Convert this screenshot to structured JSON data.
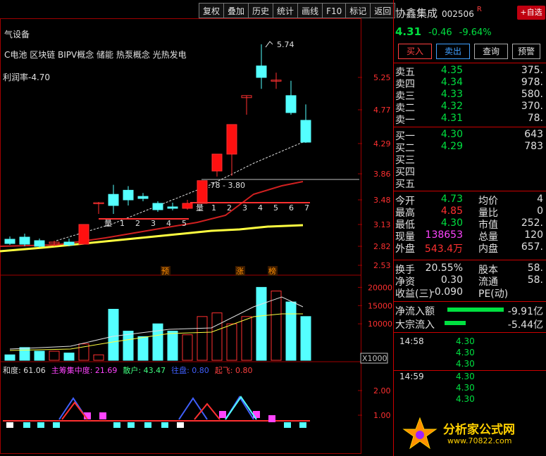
{
  "toolbar": {
    "buttons": [
      "复权",
      "叠加",
      "历史",
      "统计",
      "画线",
      "F10",
      "标记",
      "返回"
    ]
  },
  "main_chart": {
    "header_name": "气设备",
    "concepts": "C电池 区块链 BIPV概念 储能 热泵概念 光热发电",
    "profit_rate": "利润率-4.70",
    "price_ticks": [
      "5.25",
      "4.77",
      "4.29",
      "3.86",
      "3.48",
      "3.13",
      "2.82",
      "2.53"
    ],
    "high_label": "5.74",
    "range_label": "3.78 - 3.80",
    "count_left": [
      "量",
      "1",
      "2",
      "3",
      "4",
      "5"
    ],
    "count_right": [
      "量",
      "1",
      "2",
      "3",
      "4",
      "5",
      "6",
      "7"
    ],
    "markers": [
      "预",
      "涨",
      "榜"
    ]
  },
  "chart_data": {
    "type": "candlestick",
    "candles": [
      {
        "o": 2.92,
        "c": 2.86,
        "h": 2.96,
        "l": 2.84
      },
      {
        "o": 2.95,
        "c": 2.85,
        "h": 3.0,
        "l": 2.82
      },
      {
        "o": 2.9,
        "c": 2.82,
        "h": 2.93,
        "l": 2.8
      },
      {
        "o": 2.86,
        "c": 2.88,
        "h": 2.9,
        "l": 2.82
      },
      {
        "o": 2.88,
        "c": 2.84,
        "h": 2.93,
        "l": 2.82
      },
      {
        "o": 2.85,
        "c": 3.13,
        "h": 3.13,
        "l": 2.85
      },
      {
        "o": 3.43,
        "c": 3.44,
        "h": 3.45,
        "l": 3.28
      },
      {
        "o": 3.56,
        "c": 3.4,
        "h": 3.7,
        "l": 3.28
      },
      {
        "o": 3.62,
        "c": 3.48,
        "h": 3.68,
        "l": 3.4
      },
      {
        "o": 3.53,
        "c": 3.5,
        "h": 3.58,
        "l": 3.46
      },
      {
        "o": 3.43,
        "c": 3.34,
        "h": 3.46,
        "l": 3.31
      },
      {
        "o": 3.38,
        "c": 3.36,
        "h": 3.44,
        "l": 3.33
      },
      {
        "o": 3.36,
        "c": 3.43,
        "h": 3.48,
        "l": 3.34
      },
      {
        "o": 3.43,
        "c": 3.76,
        "h": 3.76,
        "l": 3.43
      },
      {
        "o": 3.9,
        "c": 4.14,
        "h": 4.14,
        "l": 3.82
      },
      {
        "o": 4.14,
        "c": 4.56,
        "h": 4.56,
        "l": 3.83
      },
      {
        "o": 4.95,
        "c": 4.98,
        "h": 4.98,
        "l": 4.7
      },
      {
        "o": 5.42,
        "c": 5.25,
        "h": 5.74,
        "l": 5.08
      },
      {
        "o": 5.2,
        "c": 5.21,
        "h": 5.32,
        "l": 5.08
      },
      {
        "o": 4.98,
        "c": 4.73,
        "h": 5.2,
        "l": 4.7
      },
      {
        "o": 4.62,
        "c": 4.31,
        "h": 4.85,
        "l": 4.3
      }
    ],
    "volume": [
      1500,
      3500,
      2500,
      2500,
      2000,
      4500,
      1500,
      14000,
      8000,
      6500,
      10000,
      8000,
      7000,
      12000,
      13000,
      10000,
      12000,
      20000,
      19000,
      16000,
      12000
    ],
    "volume_ticks": [
      "20000",
      "15000",
      "10000"
    ],
    "volume_unit": "X1000",
    "ind_ticks": [
      "2.00",
      "1.00"
    ]
  },
  "indicator": {
    "items": [
      {
        "text": "和度: 61.06",
        "color": "#e0e0e0"
      },
      {
        "text": "主筹集中度: 21.69",
        "color": "#ff44ff"
      },
      {
        "text": "散户: 43.47",
        "color": "#40ff80"
      },
      {
        "text": "往盘: 0.80",
        "color": "#4060ff"
      },
      {
        "text": "起飞: 0.80",
        "color": "#ff4040"
      }
    ]
  },
  "quote": {
    "name": "协鑫集成",
    "code": "002506",
    "r_mark": "R",
    "watch_label": "+自选",
    "price": "4.31",
    "change": "-0.46",
    "change_pct": "-9.64%",
    "buy_label": "买入",
    "sell_label": "卖出",
    "query_label": "查询",
    "preview_label": "预警",
    "asks": [
      {
        "label": "卖五",
        "price": "4.35",
        "vol": "375."
      },
      {
        "label": "卖四",
        "price": "4.34",
        "vol": "978."
      },
      {
        "label": "卖三",
        "price": "4.33",
        "vol": "580."
      },
      {
        "label": "卖二",
        "price": "4.32",
        "vol": "370."
      },
      {
        "label": "卖一",
        "price": "4.31",
        "vol": "78."
      }
    ],
    "bids": [
      {
        "label": "买一",
        "price": "4.30",
        "vol": "643"
      },
      {
        "label": "买二",
        "price": "4.29",
        "vol": "783"
      },
      {
        "label": "买三",
        "price": "",
        "vol": ""
      },
      {
        "label": "买四",
        "price": "",
        "vol": ""
      },
      {
        "label": "买五",
        "price": "",
        "vol": ""
      }
    ],
    "stats": [
      {
        "l1": "今开",
        "v1": "4.73",
        "c1": "green",
        "l2": "均价",
        "v2": "4"
      },
      {
        "l1": "最高",
        "v1": "4.85",
        "c1": "red",
        "l2": "量比",
        "v2": "0"
      },
      {
        "l1": "最低",
        "v1": "4.30",
        "c1": "green",
        "l2": "市值",
        "v2": "252."
      },
      {
        "l1": "现量",
        "v1": "138653",
        "c1": "mag",
        "l2": "总量",
        "v2": "120"
      },
      {
        "l1": "外盘",
        "v1": "543.4万",
        "c1": "red",
        "l2": "内盘",
        "v2": "657."
      }
    ],
    "stats2": [
      {
        "l1": "换手",
        "v1": "20.55%",
        "l2": "股本",
        "v2": "58."
      },
      {
        "l1": "净资",
        "v1": "0.30",
        "l2": "流通",
        "v2": "58."
      },
      {
        "l1": "收益(三)",
        "v1": "-0.090",
        "l2": "PE(动)",
        "v2": ""
      }
    ],
    "flows": [
      {
        "label": "净流入额",
        "value": "-9.91亿"
      },
      {
        "label": "大宗流入",
        "value": "-5.44亿"
      }
    ],
    "ticks": [
      {
        "time": "14:58",
        "price": "4.30"
      },
      {
        "time": "",
        "price": "4.30"
      },
      {
        "time": "",
        "price": "4.30"
      },
      {
        "time": "14:59",
        "price": "4.30"
      },
      {
        "time": "",
        "price": "4.30"
      },
      {
        "time": "",
        "price": "4.30"
      }
    ],
    "logo_text": "分析家公式网",
    "logo_url": "www.70822.com"
  }
}
